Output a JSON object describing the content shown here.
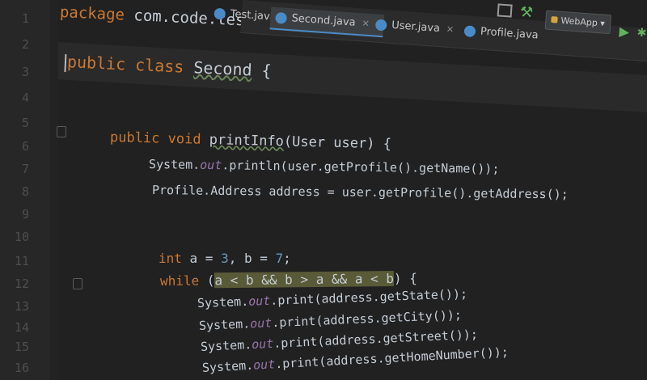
{
  "editor": {
    "tabs": [
      {
        "label": "Test.java",
        "active": false
      },
      {
        "label": "Second.java",
        "active": true
      },
      {
        "label": "User.java",
        "active": false
      },
      {
        "label": "Profile.java",
        "active": false
      }
    ],
    "run_config_label": "WebApp",
    "line_numbers": [
      "1",
      "2",
      "3",
      "4",
      "5",
      "6",
      "7",
      "8",
      "9",
      "10",
      "11",
      "12",
      "13",
      "14",
      "15",
      "16"
    ],
    "code": {
      "l1": {
        "kw": "package",
        "rest": " com.code.test;"
      },
      "l3": {
        "kw": "public class",
        "name": "Second",
        "rest": " {"
      },
      "l6": {
        "kw": "public void",
        "name": "printInfo",
        "rest": "(User user) {"
      },
      "l7": {
        "a": "System.",
        "field": "out",
        "b": ".println(user.getProfile().getName());"
      },
      "l8": {
        "a": "Profile.Address address = user.getProfile().getAddress();"
      },
      "l11": {
        "kw": "int",
        "a": " a = ",
        "n1": "3",
        "b": ", b = ",
        "n2": "7",
        "c": ";"
      },
      "l12": {
        "kw": "while",
        "a": " (",
        "hl": "a < b && b > a && a < b",
        "b": ") {"
      },
      "l13": {
        "a": "System.",
        "field": "out",
        "b": ".print(address.getState());"
      },
      "l14": {
        "a": "System.",
        "field": "out",
        "b": ".print(address.getCity());"
      },
      "l15": {
        "a": "System.",
        "field": "out",
        "b": ".print(address.getStreet());"
      },
      "l16": {
        "a": "System.",
        "field": "out",
        "b": ".print(address.getHomeNumber());"
      }
    }
  },
  "colors": {
    "keyword": "#cc7832",
    "field": "#9876aa",
    "number": "#6897bb",
    "text": "#c5cdd6",
    "background": "#212121",
    "highlight": "#595a37"
  }
}
